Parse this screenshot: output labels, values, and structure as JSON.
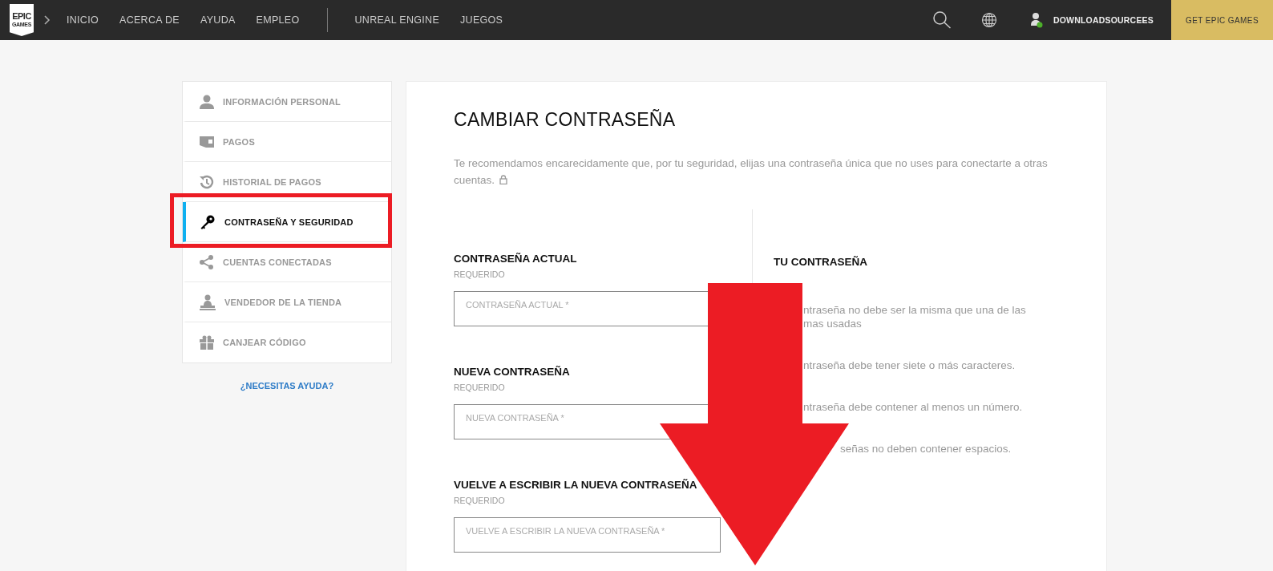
{
  "nav": {
    "logo": {
      "top": "EPIC",
      "bottom": "GAMES"
    },
    "links": [
      {
        "label": "INICIO"
      },
      {
        "label": "ACERCA DE"
      },
      {
        "label": "AYUDA"
      },
      {
        "label": "EMPLEO"
      }
    ],
    "links_secondary": [
      {
        "label": "UNREAL ENGINE"
      },
      {
        "label": "JUEGOS"
      }
    ],
    "user": {
      "name": "DOWNLOADSOURCEES",
      "online": true
    },
    "cta": "GET EPIC GAMES"
  },
  "sidebar": {
    "items": [
      {
        "label": "INFORMACIÓN PERSONAL",
        "selected": false
      },
      {
        "label": "PAGOS",
        "selected": false
      },
      {
        "label": "HISTORIAL DE PAGOS",
        "selected": false
      },
      {
        "label": "CONTRASEÑA Y SEGURIDAD",
        "selected": true
      },
      {
        "label": "CUENTAS CONECTADAS",
        "selected": false
      },
      {
        "label": "VENDEDOR DE LA TIENDA",
        "selected": false
      },
      {
        "label": "CANJEAR CÓDIGO",
        "selected": false
      }
    ],
    "help_link": "¿NECESITAS AYUDA?"
  },
  "main": {
    "title": "CAMBIAR CONTRASEÑA",
    "intro": "Te recomendamos encarecidamente que, por tu seguridad, elijas una contraseña única que no uses para conectarte a otras cuentas.",
    "fields": [
      {
        "label": "CONTRASEÑA ACTUAL",
        "note": "REQUERIDO",
        "placeholder": "CONTRASEÑA ACTUAL *"
      },
      {
        "label": "NUEVA CONTRASEÑA",
        "note": "REQUERIDO",
        "placeholder": "NUEVA CONTRASEÑA *"
      },
      {
        "label": "VUELVE A ESCRIBIR LA NUEVA CONTRASEÑA",
        "note": "REQUERIDO",
        "placeholder": "VUELVE A ESCRIBIR LA NUEVA CONTRASEÑA *"
      }
    ],
    "rules_title": "TU CONTRASEÑA",
    "rules": [
      {
        "lines": [
          "ntraseña no debe ser la misma que una de las",
          "mas usadas"
        ]
      },
      {
        "lines": [
          "ntraseña debe tener siete o más caracteres."
        ]
      },
      {
        "lines": [
          "ntraseña debe contener al menos un número."
        ]
      },
      {
        "lines": [
          "señas no deben contener espacios."
        ]
      }
    ]
  }
}
